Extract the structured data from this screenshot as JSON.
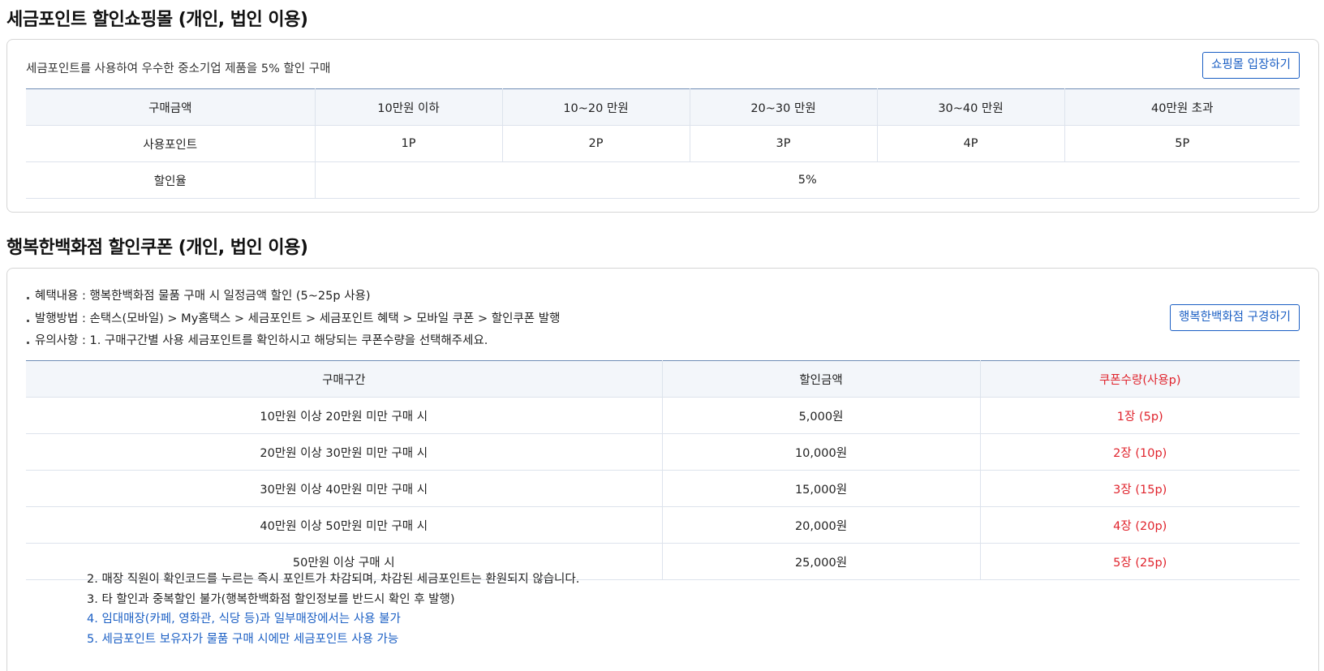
{
  "section1": {
    "title": "세금포인트 할인쇼핑몰 (개인, 법인 이용)",
    "intro": "세금포인트를 사용하여 우수한 중소기업 제품을 5% 할인 구매",
    "button": "쇼핑몰 입장하기",
    "table": {
      "row_header": "구매금액",
      "columns": [
        "10만원 이하",
        "10~20 만원",
        "20~30 만원",
        "30~40 만원",
        "40만원 초과"
      ],
      "points_label": "사용포인트",
      "points": [
        "1P",
        "2P",
        "3P",
        "4P",
        "5P"
      ],
      "rate_label": "할인율",
      "rate": "5%"
    }
  },
  "section2": {
    "title": "행복한백화점 할인쿠폰 (개인, 법인 이용)",
    "bullets": [
      "혜택내용 : 행복한백화점 물품 구매 시 일정금액 할인 (5~25p 사용)",
      "발행방법 : 손택스(모바일) > My홈택스 > 세금포인트 > 세금포인트 혜택 > 모바일 쿠폰 > 할인쿠폰 발행",
      "유의사항 : 1. 구매구간별 사용 세금포인트를 확인하시고 해당되는 쿠폰수량을 선택해주세요."
    ],
    "button": "행복한백화점 구경하기",
    "table": {
      "headers": [
        "구매구간",
        "할인금액",
        "쿠폰수량(사용p)"
      ],
      "rows": [
        [
          "10만원 이상 20만원 미만 구매 시",
          "5,000원",
          "1장 (5p)"
        ],
        [
          "20만원 이상 30만원 미만 구매 시",
          "10,000원",
          "2장 (10p)"
        ],
        [
          "30만원 이상 40만원 미만 구매 시",
          "15,000원",
          "3장 (15p)"
        ],
        [
          "40만원 이상 50만원 미만 구매 시",
          "20,000원",
          "4장 (20p)"
        ],
        [
          "50만원 이상 구매 시",
          "25,000원",
          "5장 (25p)"
        ]
      ]
    },
    "notes": [
      "2. 매장 직원이 확인코드를 누르는 즉시 포인트가 차감되며, 차감된 세금포인트는 환원되지 않습니다.",
      "3. 타 할인과 중복할인 불가(행복한백화점 할인정보를 반드시 확인 후 발행)",
      "4. 임대매장(카페, 영화관, 식당 등)과 일부매장에서는 사용 불가",
      "5. 세금포인트 보유자가 물품 구매 시에만 세금포인트 사용 가능"
    ],
    "colors": {
      "accent_blue": "#1b5fc4",
      "coupon_red": "#e0242d"
    }
  }
}
